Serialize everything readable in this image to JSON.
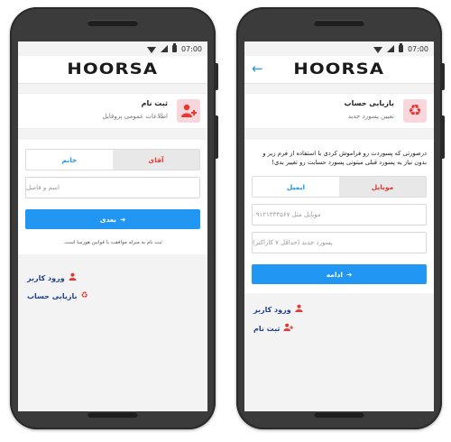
{
  "status": {
    "time": "07:00"
  },
  "app": {
    "logo": "HOORSA"
  },
  "icons": {
    "back": "arrow-left-icon",
    "user": "user-icon",
    "recycle": "recycle-icon",
    "add_user": "user-plus-icon",
    "arrow": "arrow-right-icon"
  },
  "colors": {
    "primary": "#2196F3",
    "accent": "#e53935",
    "link": "#1f3f8f"
  },
  "left": {
    "header": {
      "title": "ثبت نام",
      "subtitle": "اطلاعات عمومی پروفایل"
    },
    "tabs": {
      "active": "آقای",
      "other": "خانم"
    },
    "name_placeholder": "اسم و فامیل",
    "next_button": "بعدی",
    "terms": "ثبت نام به منزله موافقت با قوانین هورسا است.",
    "links": {
      "login": "ورود کاربر",
      "recovery": "بازیابی حساب"
    }
  },
  "right": {
    "header": {
      "title": "بازیابی حساب",
      "subtitle": "تعیین پسورد جدید"
    },
    "description": "درصورتی که پسوردت رو فراموش کردی با استفاده از فرم زیر و بدون نیاز به پسورد قبلی میتونی پسورد حسابت رو تغییر بدی!",
    "tabs": {
      "active": "موبایل",
      "other": "ایمیل"
    },
    "mobile_placeholder": "موبایل مثل ۰۹۱۲۱۲۳۴۵۶۷",
    "password_placeholder": "پسورد جدید (حداقل ۷ کاراکتر)",
    "continue_button": "ادامه",
    "links": {
      "login": "ورود کاربر",
      "register": "ثبت نام"
    }
  }
}
